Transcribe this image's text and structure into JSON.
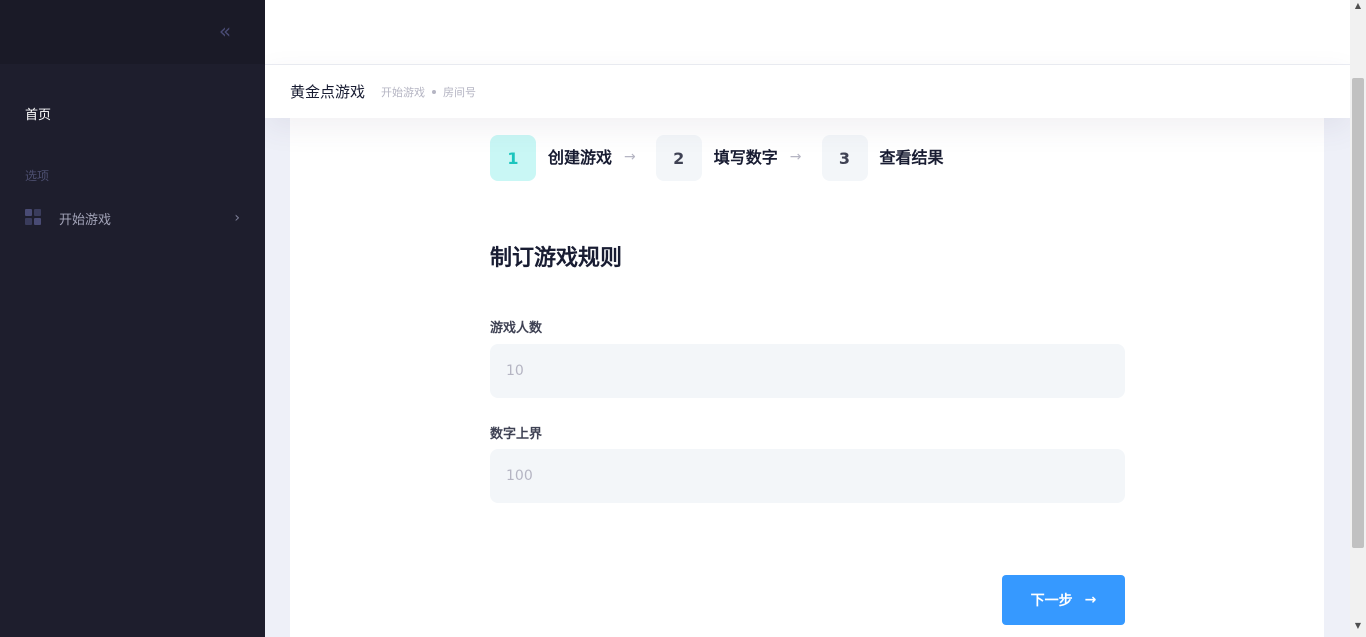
{
  "sidebar": {
    "collapse_icon": "double-chevron-left-icon",
    "home_label": "首页",
    "section_label": "选项",
    "items": [
      {
        "label": "开始游戏",
        "icon": "grid-icon"
      }
    ]
  },
  "subheader": {
    "title": "黄金点游戏",
    "breadcrumbs": [
      "开始游戏",
      "房间号"
    ]
  },
  "steps": [
    {
      "number": "1",
      "label": "创建游戏",
      "active": true
    },
    {
      "number": "2",
      "label": "填写数字",
      "active": false
    },
    {
      "number": "3",
      "label": "查看结果",
      "active": false
    }
  ],
  "form": {
    "title": "制订游戏规则",
    "fields": [
      {
        "label": "游戏人数",
        "placeholder": "10",
        "value": ""
      },
      {
        "label": "数字上界",
        "placeholder": "100",
        "value": ""
      }
    ],
    "next_label": "下一步"
  },
  "colors": {
    "sidebar_bg": "#1e1e2d",
    "accent": "#3699ff",
    "active_step": "#1bc5bd"
  }
}
